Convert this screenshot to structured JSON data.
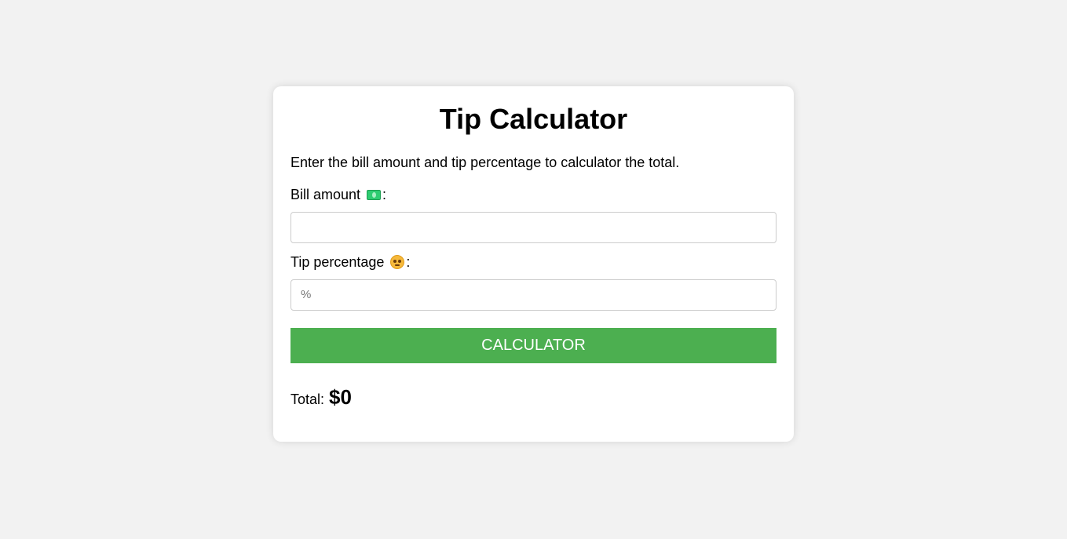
{
  "calculator": {
    "title": "Tip Calculator",
    "description": "Enter the bill amount and tip percentage to calculator the total.",
    "bill_label": "Bill amount",
    "bill_colon": ":",
    "bill_value": "",
    "bill_placeholder": "",
    "tip_label": "Tip percentage",
    "tip_colon": ":",
    "tip_value": "",
    "tip_placeholder": "%",
    "button_label": "CALCULATOR",
    "total_label": "Total:",
    "total_value": "$0"
  },
  "colors": {
    "background": "#f2f2f2",
    "card": "#ffffff",
    "button": "#4caf50",
    "button_text": "#ffffff"
  },
  "icons": {
    "bill_icon": "money-banknote-icon",
    "tip_icon": "pleading-face-icon"
  }
}
